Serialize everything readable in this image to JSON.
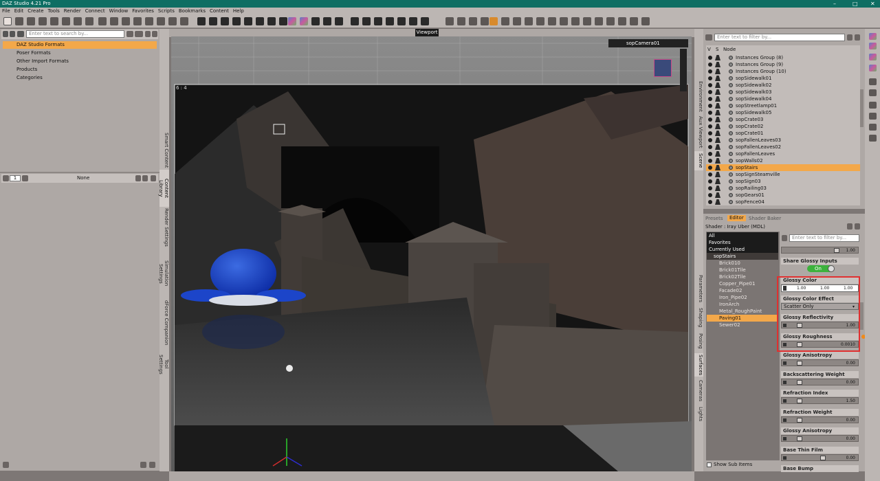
{
  "app": {
    "title": "DAZ Studio 4.21 Pro"
  },
  "menu": [
    "File",
    "Edit",
    "Create",
    "Tools",
    "Render",
    "Connect",
    "Window",
    "Favorites",
    "Scripts",
    "Bookmarks",
    "Content",
    "Help"
  ],
  "window_controls": [
    "–",
    "□",
    "✕"
  ],
  "content_library": {
    "search_placeholder": "Enter text to search by...",
    "tree": [
      "DAZ Studio Formats",
      "Poser Formats",
      "Other Import Formats",
      "Products",
      "Categories"
    ],
    "page_number": "1",
    "filter_value": "None"
  },
  "left_tabs": [
    "Smart Content",
    "Content Library",
    "Render Settings",
    "Simulation Settings",
    "dForce Companion",
    "Tool Settings"
  ],
  "viewport": {
    "tooltip": "Viewport",
    "camera": "sopCamera01",
    "aspect": "6 : 4"
  },
  "scene": {
    "filter_placeholder": "Enter text to filter by...",
    "cols": [
      "V",
      "S",
      "Node"
    ],
    "nodes": [
      "Instances Group (8)",
      "Instances Group (9)",
      "Instances Group (10)",
      "sopSidewalk01",
      "sopSidewalk02",
      "sopSidewalk03",
      "sopSidewalk04",
      "sopStreetlamp01",
      "sopSidewalk05",
      "sopCrate03",
      "sopCrate02",
      "sopCrate01",
      "sopFallenLeaves03",
      "sopFallenLeaves02",
      "sopFallenLeaves",
      "sopWalls02",
      "sopStairs",
      "sopSignSteamville",
      "sopSign03",
      "sopRailing03",
      "sopGears01",
      "sopFence04"
    ],
    "selected": "sopStairs"
  },
  "right_vtabs_top": [
    "Environment",
    "Aux Viewport",
    "Scene"
  ],
  "right_vtabs_bottom": [
    "Parameters",
    "Shaping",
    "Posing",
    "Surfaces",
    "Cameras",
    "Lights"
  ],
  "surfaces": {
    "tabs": [
      "Presets",
      "Editor",
      "Shader Baker"
    ],
    "shader": "Shader : Iray Uber (MDL)",
    "filter_placeholder": "Enter text to filter by...",
    "groups": [
      "All",
      "Favorites",
      "Currently Used"
    ],
    "root": "sopStairs",
    "items": [
      "Brick010",
      "Brick01Tile",
      "Brick02Tile",
      "Copper_Pipe01",
      "Facade02",
      "Iron_Pipe02",
      "IronArch",
      "Metal_RoughPaint",
      "Paving01",
      "Sewer02"
    ],
    "selected_item": "Paving01",
    "show_sub_items": "Show Sub Items",
    "top_value": "1.00",
    "share_glossy": {
      "label": "Share Glossy Inputs",
      "value": "On"
    },
    "glossy_color": {
      "label": "Glossy Color",
      "values": [
        "1.00",
        "1.00",
        "1.00"
      ]
    },
    "glossy_color_effect": {
      "label": "Glossy Color Effect",
      "value": "Scatter Only"
    },
    "properties": [
      {
        "label": "Glossy Reflectivity",
        "value": "1.00",
        "level": 0.14
      },
      {
        "label": "Glossy Roughness",
        "value": "0.0010",
        "level": 0.14
      },
      {
        "label": "Glossy Anisotropy",
        "value": "0.00",
        "level": 0.14
      },
      {
        "label": "Backscattering Weight",
        "value": "0.00",
        "level": 0.14
      },
      {
        "label": "Refraction Index",
        "value": "1.50",
        "level": 0.14
      },
      {
        "label": "Refraction Weight",
        "value": "0.00",
        "level": 0.14
      },
      {
        "label": "Glossy Anisotropy Rotations",
        "value": "0.00",
        "level": 0.14
      },
      {
        "label": "Base Thin Film",
        "value": "0.00",
        "level": 0.48
      },
      {
        "label": "Base Bump",
        "value": "",
        "level": 0
      }
    ]
  },
  "colors": {
    "accent": "#f3a84a",
    "title_bar": "#0e6e63",
    "highlight": "#e03030",
    "toggle_on": "#3cb23c"
  }
}
